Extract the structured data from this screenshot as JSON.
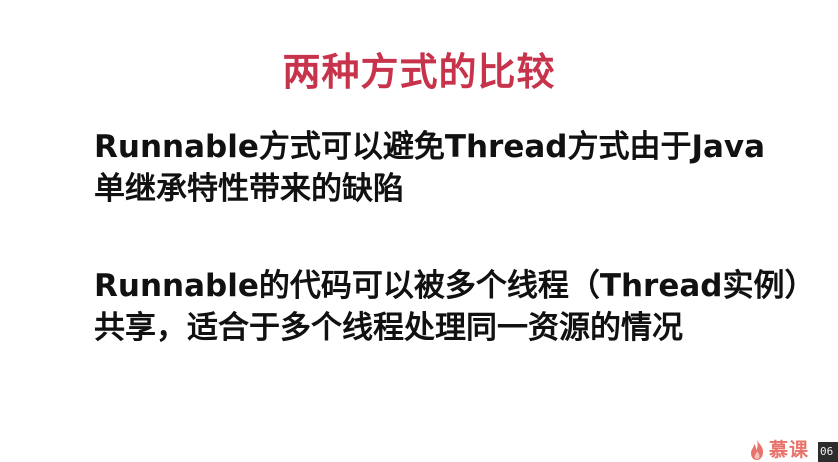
{
  "slide": {
    "title": "两种方式的比较",
    "points": [
      {
        "lines": [
          "Runnable方式可以避免Thread方式由于Java",
          "单继承特性带来的缺陷"
        ]
      },
      {
        "lines": [
          "Runnable的代码可以被多个线程（Thread实例）",
          "共享，适合于多个线程处理同一资源的情况"
        ]
      }
    ]
  },
  "watermark": {
    "text": "慕课",
    "icon": "flame-logo-icon",
    "color": "#e8736a"
  },
  "player": {
    "timestamp": "06"
  },
  "colors": {
    "title": "#c8334c",
    "body_text": "#111111",
    "background": "#ffffff"
  }
}
